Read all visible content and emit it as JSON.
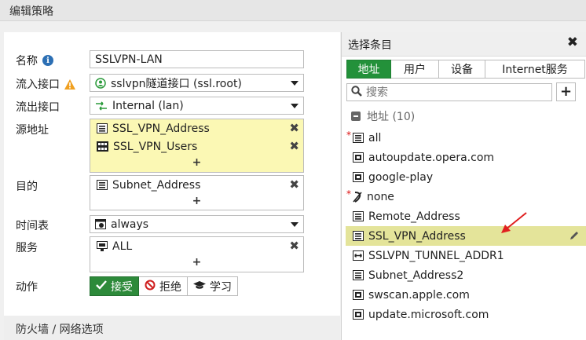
{
  "window_title": "编辑策略",
  "form": {
    "name_label": "名称",
    "name_value": "SSLVPN-LAN",
    "incoming_label": "流入接口",
    "incoming_value": "sslvpn隧道接口 (ssl.root)",
    "outgoing_label": "流出接口",
    "outgoing_value": "Internal (lan)",
    "source_label": "源地址",
    "source_entries": [
      "SSL_VPN_Address",
      "SSL_VPN_Users"
    ],
    "dest_label": "目的",
    "dest_entries": [
      "Subnet_Address"
    ],
    "schedule_label": "时间表",
    "schedule_value": "always",
    "service_label": "服务",
    "service_entries": [
      "ALL"
    ],
    "add_symbol": "+",
    "remove_symbol": "✖",
    "action_label": "动作",
    "actions": [
      "接受",
      "拒绝",
      "学习"
    ],
    "firewall_section": "防火墙 / 网络选项"
  },
  "picker": {
    "title": "选择条目",
    "close_symbol": "✖",
    "tabs": [
      "地址",
      "用户",
      "设备",
      "Internet服务"
    ],
    "search_placeholder": "搜索",
    "add_symbol": "+",
    "group_label": "地址 (10)",
    "items": [
      {
        "label": "all",
        "required": true,
        "icon": "address-icon"
      },
      {
        "label": "autoupdate.opera.com",
        "required": false,
        "icon": "fqdn-icon"
      },
      {
        "label": "google-play",
        "required": false,
        "icon": "fqdn-icon"
      },
      {
        "label": "none",
        "required": true,
        "icon": "none-icon"
      },
      {
        "label": "Remote_Address",
        "required": false,
        "icon": "address-icon"
      },
      {
        "label": "SSL_VPN_Address",
        "required": false,
        "icon": "address-icon",
        "selected": true
      },
      {
        "label": "SSLVPN_TUNNEL_ADDR1",
        "required": false,
        "icon": "range-icon"
      },
      {
        "label": "Subnet_Address2",
        "required": false,
        "icon": "address-icon"
      },
      {
        "label": "swscan.apple.com",
        "required": false,
        "icon": "fqdn-icon"
      },
      {
        "label": "update.microsoft.com",
        "required": false,
        "icon": "fqdn-icon"
      }
    ],
    "required_mark": "*"
  },
  "colors": {
    "accent_green": "#23913a",
    "highlight_yellow": "#fbf8b4",
    "selected_row": "#e4e49a",
    "arrow_red": "#e02020"
  }
}
